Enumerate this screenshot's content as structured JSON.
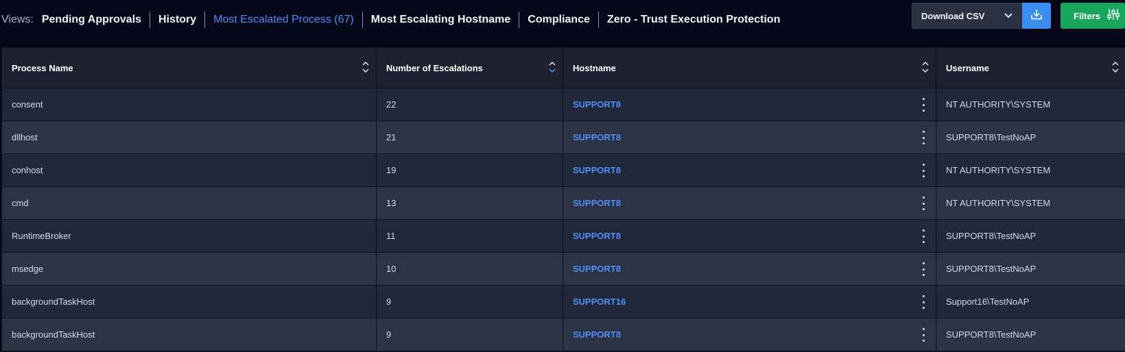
{
  "views": {
    "label": "Views:",
    "tabs": [
      {
        "label": "Pending Approvals",
        "active": false
      },
      {
        "label": "History",
        "active": false
      },
      {
        "label": "Most Escalated Process (67)",
        "active": true
      },
      {
        "label": "Most Escalating Hostname",
        "active": false
      },
      {
        "label": "Compliance",
        "active": false
      },
      {
        "label": "Zero - Trust Execution Protection",
        "active": false
      }
    ]
  },
  "toolbar": {
    "download_select": "Download CSV",
    "filters_label": "Filters"
  },
  "table": {
    "columns": [
      "Process Name",
      "Number of Escalations",
      "Hostname",
      "Username"
    ],
    "rows": [
      {
        "process": "consent",
        "escalations": "22",
        "hostname": "SUPPORT8",
        "username": "NT AUTHORITY\\SYSTEM"
      },
      {
        "process": "dllhost",
        "escalations": "21",
        "hostname": "SUPPORT8",
        "username": "SUPPORT8\\TestNoAP"
      },
      {
        "process": "conhost",
        "escalations": "19",
        "hostname": "SUPPORT8",
        "username": "NT AUTHORITY\\SYSTEM"
      },
      {
        "process": "cmd",
        "escalations": "13",
        "hostname": "SUPPORT8",
        "username": "NT AUTHORITY\\SYSTEM"
      },
      {
        "process": "RuntimeBroker",
        "escalations": "11",
        "hostname": "SUPPORT8",
        "username": "SUPPORT8\\TestNoAP"
      },
      {
        "process": "msedge",
        "escalations": "10",
        "hostname": "SUPPORT8",
        "username": "SUPPORT8\\TestNoAP"
      },
      {
        "process": "backgroundTaskHost",
        "escalations": "9",
        "hostname": "SUPPORT16",
        "username": "Support16\\TestNoAP"
      },
      {
        "process": "backgroundTaskHost",
        "escalations": "9",
        "hostname": "SUPPORT8",
        "username": "SUPPORT8\\TestNoAP"
      }
    ]
  },
  "colors": {
    "background": "#050819",
    "accent_blue": "#4f8ef7",
    "filters_green": "#1aa55e",
    "download_blue": "#3b8cf0"
  },
  "icons": {
    "download": "download-icon",
    "filters": "sliders-icon",
    "dropdown": "chevron-down-icon",
    "sort": "sort-icon",
    "row_menu": "kebab-menu-icon"
  }
}
